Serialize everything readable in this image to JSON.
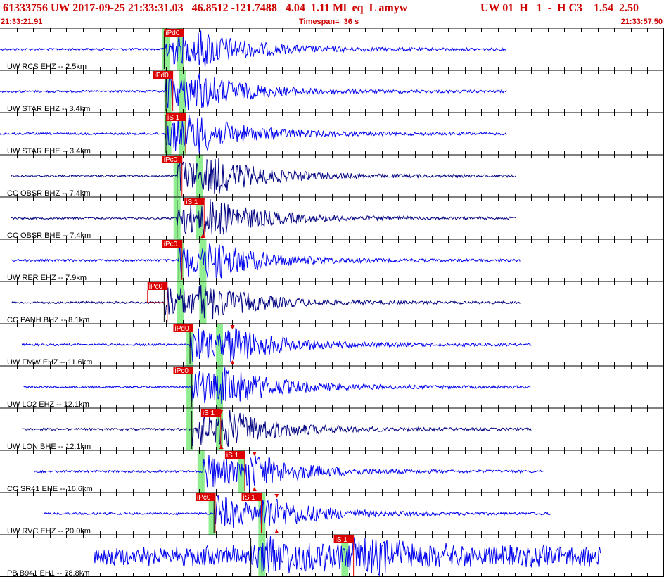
{
  "header": {
    "event_line": "61333756 UW 2017-09-25 21:33:31.03   46.8512 -121.7488   4.04  1.11 Ml  eq  L amyw",
    "event_line_right": "UW 01  H   1  -  H C3    1.54  2.50",
    "start_time": "21:33:21.91",
    "timespan": "Timespan=  36 s",
    "end_time": "21:33:57.50"
  },
  "colors": {
    "header_text": "#cc0000",
    "trace_blue": "#0000ee",
    "trace_navy": "#000080",
    "pick_box": "#dd0000",
    "pick_band": "#90ee90",
    "grid": "#000000"
  },
  "traces": [
    {
      "label": "UW RCS EHZ -- 2.5km",
      "color": "blue",
      "start": 0.0,
      "end": 27.5,
      "onset": 8.9,
      "s_onset": 10.5,
      "picks": [
        {
          "text": "iPd0",
          "at": 8.9
        }
      ],
      "bands": [
        9.0,
        9.8
      ]
    },
    {
      "label": "UW STAR EHZ -- 3.4km",
      "color": "blue",
      "start": 0.0,
      "end": 27.5,
      "onset": 9.0,
      "s_onset": 10.0,
      "picks": [
        {
          "text": "iPd0",
          "at": 8.3
        }
      ],
      "bands": [
        9.1,
        9.9
      ]
    },
    {
      "label": "UW STAR EHE -- 3.4km",
      "color": "blue",
      "start": 0.0,
      "end": 27.5,
      "onset": 9.0,
      "s_onset": 10.0,
      "picks": [
        {
          "text": "iS 1",
          "at": 9.0
        }
      ],
      "bands": [
        9.1,
        9.9
      ]
    },
    {
      "label": "CC OBSR BHZ -- 7.4km",
      "color": "navy",
      "start": 0.6,
      "end": 28.0,
      "onset": 9.6,
      "s_onset": 11.0,
      "picks": [
        {
          "text": "iPc0",
          "at": 8.8
        }
      ],
      "bands": [
        9.6,
        10.8
      ]
    },
    {
      "label": "CC OBSR BHE -- 7.4km",
      "color": "navy",
      "start": 0.6,
      "end": 28.0,
      "onset": 9.6,
      "s_onset": 11.0,
      "picks": [
        {
          "text": "iS 1",
          "at": 10.0
        }
      ],
      "bands": [
        9.6,
        10.8
      ],
      "marker": 11.0
    },
    {
      "label": "UW RER EHZ -- 7.9km",
      "color": "blue",
      "start": 0.6,
      "end": 28.2,
      "onset": 9.7,
      "s_onset": 11.0,
      "picks": [
        {
          "text": "iPc0",
          "at": 8.8
        }
      ],
      "bands": [
        9.8,
        11.0
      ]
    },
    {
      "label": "CC PANH BHZ -- 8.1km",
      "color": "navy",
      "start": 0.6,
      "end": 28.2,
      "onset": 8.9,
      "s_onset": 10.8,
      "picks": [
        {
          "text": "iPc0",
          "at": 8.0
        }
      ],
      "bands": [
        9.8,
        11.0
      ],
      "flag": 8.0
    },
    {
      "label": "UW FMW EHZ -- 11.6km",
      "color": "blue",
      "start": 1.2,
      "end": 28.8,
      "onset": 10.3,
      "s_onset": 12.2,
      "picks": [
        {
          "text": "iPd0",
          "at": 9.4
        }
      ],
      "bands": [
        10.3,
        11.9
      ],
      "marker": 12.6
    },
    {
      "label": "UW LO2 EHZ -- 12.1km",
      "color": "blue",
      "start": 1.3,
      "end": 28.8,
      "onset": 10.4,
      "s_onset": 12.0,
      "picks": [
        {
          "text": "iPc0",
          "at": 9.4
        }
      ],
      "bands": [
        10.3,
        11.9
      ]
    },
    {
      "label": "UW LON BHE -- 12.1km",
      "color": "navy",
      "start": 1.2,
      "end": 28.8,
      "onset": 10.4,
      "s_onset": 11.9,
      "picks": [
        {
          "text": "iS 1",
          "at": 10.9
        }
      ],
      "bands": [
        10.3,
        11.9
      ],
      "marker": 12.0
    },
    {
      "label": "CC SR41 EHE -- 16.6km",
      "color": "blue",
      "start": 1.9,
      "end": 29.5,
      "onset": 11.0,
      "s_onset": 13.3,
      "picks": [
        {
          "text": "iS 1",
          "at": 12.2
        }
      ],
      "bands": [
        10.9,
        13.1
      ],
      "marker": 13.8
    },
    {
      "label": "UW RVC EHZ -- 20.0km",
      "color": "blue",
      "start": 2.4,
      "end": 29.9,
      "onset": 11.6,
      "s_onset": 14.1,
      "picks": [
        {
          "text": "iPc0",
          "at": 10.6
        },
        {
          "text": "iS 1",
          "at": 13.1
        }
      ],
      "bands": [
        11.5,
        14.2
      ],
      "marker": 15.0
    },
    {
      "label": "PB B941 EH1 -- 38.8km",
      "color": "blue",
      "start": 5.1,
      "end": 32.6,
      "onset": 13.6,
      "s_onset": 19.1,
      "picks": [
        {
          "text": "iS 1",
          "at": 18.1
        }
      ],
      "bands": [
        14.2,
        18.7
      ]
    }
  ]
}
